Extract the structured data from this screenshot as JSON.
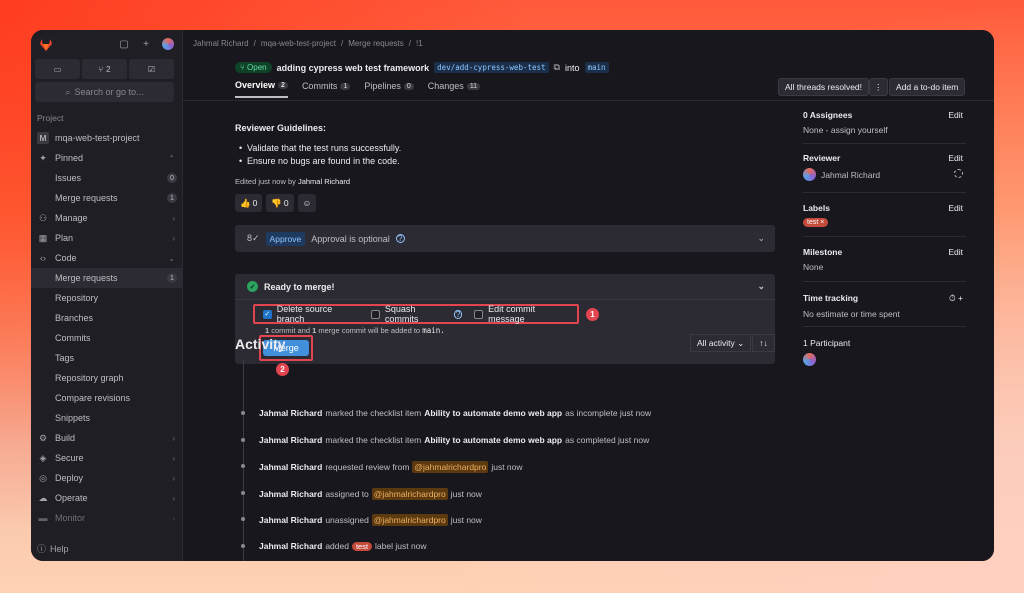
{
  "sidebar": {
    "tab_mr_count": "2",
    "search_placeholder": "Search or go to...",
    "section_label": "Project",
    "project_initial": "M",
    "project_name": "mqa-web-test-project",
    "items": [
      {
        "label": "Pinned"
      },
      {
        "label": "Issues",
        "count": "0"
      },
      {
        "label": "Merge requests",
        "count": "1"
      },
      {
        "label": "Manage"
      },
      {
        "label": "Plan"
      },
      {
        "label": "Code"
      },
      {
        "label": "Merge requests",
        "count": "1"
      },
      {
        "label": "Repository"
      },
      {
        "label": "Branches"
      },
      {
        "label": "Commits"
      },
      {
        "label": "Tags"
      },
      {
        "label": "Repository graph"
      },
      {
        "label": "Compare revisions"
      },
      {
        "label": "Snippets"
      },
      {
        "label": "Build"
      },
      {
        "label": "Secure"
      },
      {
        "label": "Deploy"
      },
      {
        "label": "Operate"
      },
      {
        "label": "Monitor"
      }
    ],
    "help": "Help"
  },
  "breadcrumb": [
    "Jahmal Richard",
    "/",
    "mqa-web-test-project",
    "/",
    "Merge requests",
    "/",
    "!1"
  ],
  "mr": {
    "status": "Open",
    "title": "adding cypress web test framework",
    "source_branch": "dev/add-cypress-web-test",
    "into": "into",
    "target_branch": "main",
    "tabs": [
      {
        "label": "Overview",
        "count": "2"
      },
      {
        "label": "Commits",
        "count": "1"
      },
      {
        "label": "Pipelines",
        "count": "0"
      },
      {
        "label": "Changes",
        "count": "11"
      }
    ],
    "threads_resolved": "All threads resolved!",
    "todo_button": "Add a to-do item"
  },
  "description": {
    "heading": "Reviewer Guidelines:",
    "bullets": [
      "Validate that the test runs successfully.",
      "Ensure no bugs are found in the code."
    ],
    "edited_prefix": "Edited just now by",
    "edited_by": "Jahmal Richard",
    "thumbs_up": "0",
    "thumbs_down": "0"
  },
  "approval": {
    "button": "Approve",
    "text": "Approval is optional"
  },
  "merge_widget": {
    "status": "Ready to merge!",
    "delete_source": "Delete source branch",
    "squash": "Squash commits",
    "edit_message": "Edit commit message",
    "info_a": "1",
    "info_b": "commit and",
    "info_c": "1",
    "info_d": "merge commit will be added to",
    "info_branch": "main.",
    "merge_button": "Merge",
    "marker1": "1",
    "marker2": "2"
  },
  "activity": {
    "title": "Activity",
    "filter": "All activity",
    "entries": [
      {
        "user": "Jahmal Richard",
        "pre": "marked the checklist item",
        "obj": "Ability to automate demo web app",
        "post": "as incomplete just now"
      },
      {
        "user": "Jahmal Richard",
        "pre": "marked the checklist item",
        "obj": "Ability to automate demo web app",
        "post": "as completed just now"
      },
      {
        "user": "Jahmal Richard",
        "pre": "requested review from",
        "mention": "@jahmalrichardpro",
        "post": "just now"
      },
      {
        "user": "Jahmal Richard",
        "pre": "assigned to",
        "mention": "@jahmalrichardpro",
        "post": "just now"
      },
      {
        "user": "Jahmal Richard",
        "pre": "unassigned",
        "mention": "@jahmalrichardpro",
        "post": "just now"
      },
      {
        "user": "Jahmal Richard",
        "pre": "added",
        "label": "test",
        "post": "label just now"
      }
    ]
  },
  "right": {
    "assignees_h": "0 Assignees",
    "edit": "Edit",
    "assignees_v": "None - assign yourself",
    "reviewer_h": "Reviewer",
    "reviewer_v": "Jahmal Richard",
    "labels_h": "Labels",
    "label_v": "test",
    "milestone_h": "Milestone",
    "milestone_v": "None",
    "time_h": "Time tracking",
    "time_v": "No estimate or time spent",
    "participants_h": "1 Participant"
  }
}
